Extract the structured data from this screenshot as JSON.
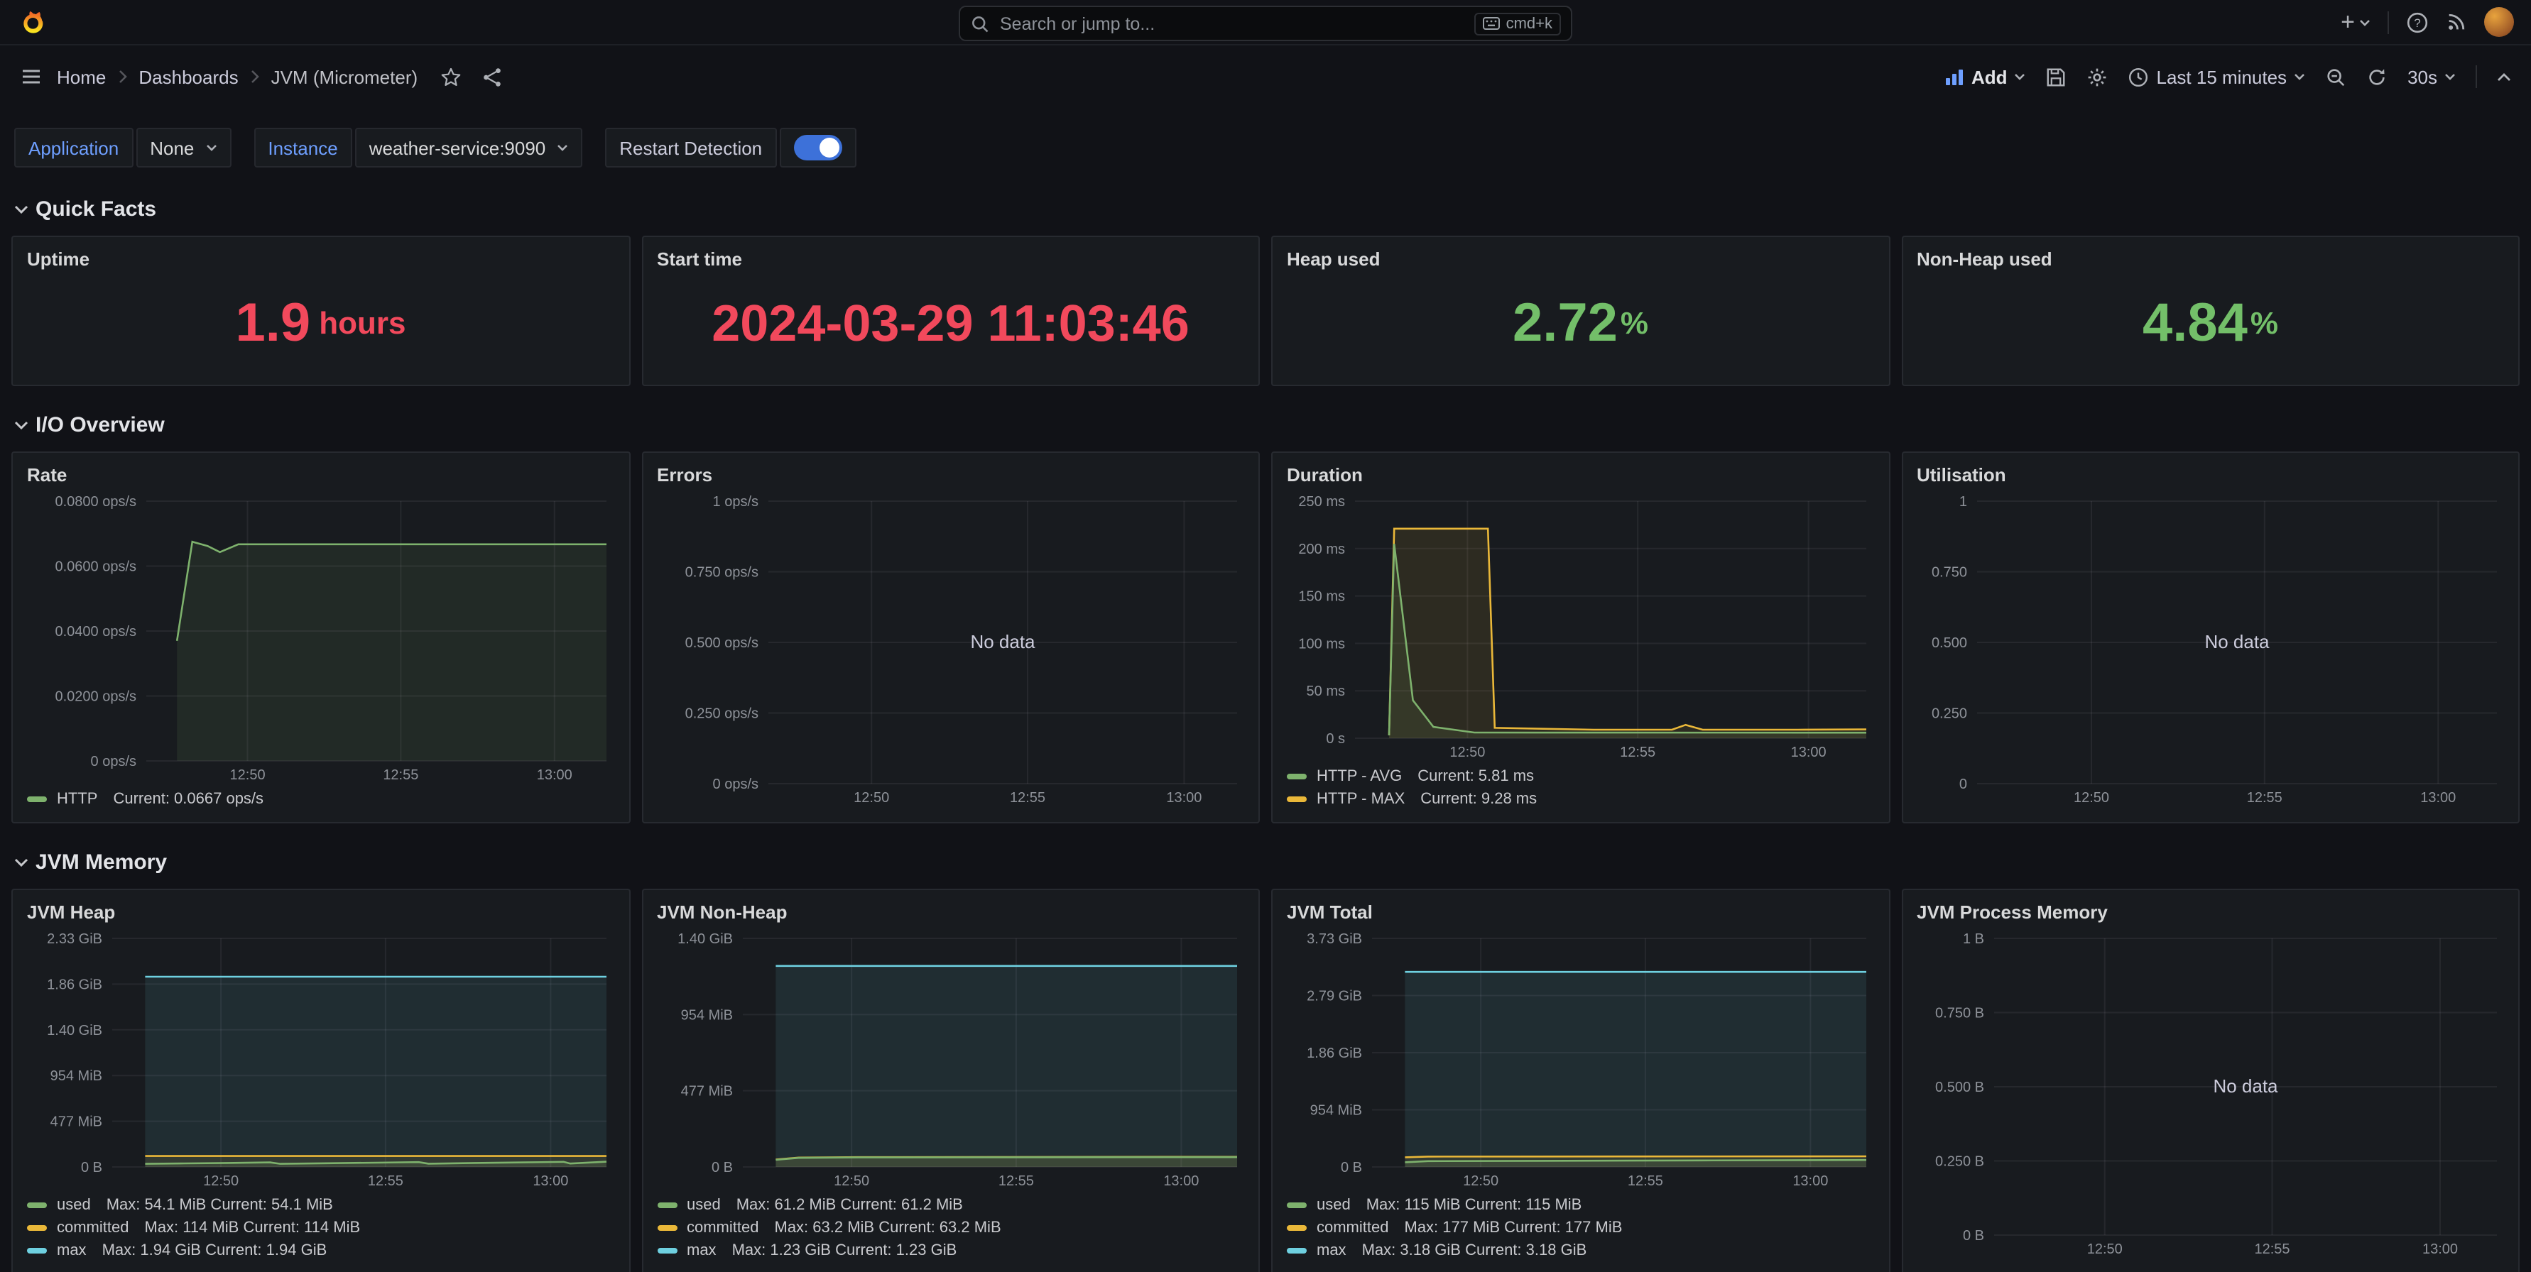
{
  "app": {
    "search_placeholder": "Search or jump to...",
    "shortcut": "cmd+k"
  },
  "breadcrumb": {
    "items": [
      "Home",
      "Dashboards",
      "JVM (Micrometer)"
    ]
  },
  "toolbar": {
    "add_label": "Add",
    "time_range": "Last 15 minutes",
    "refresh_interval": "30s"
  },
  "filters": {
    "application_label": "Application",
    "application_value": "None",
    "instance_label": "Instance",
    "instance_value": "weather-service:9090",
    "restart_detection_label": "Restart Detection",
    "restart_detection_enabled": true
  },
  "sections": {
    "quick_facts": "Quick Facts",
    "io_overview": "I/O Overview",
    "jvm_memory": "JVM Memory"
  },
  "quick_facts": {
    "panels": [
      {
        "title": "Uptime",
        "value": "1.9",
        "suffix": "hours",
        "color": "#F2495C"
      },
      {
        "title": "Start time",
        "value": "2024-03-29 11:03:46",
        "suffix": "",
        "color": "#F2495C"
      },
      {
        "title": "Heap used",
        "value": "2.72",
        "suffix": "%",
        "color": "#73BF69"
      },
      {
        "title": "Non-Heap used",
        "value": "4.84",
        "suffix": "%",
        "color": "#73BF69"
      }
    ]
  },
  "chart_data": {
    "rate": {
      "type": "line",
      "title": "Rate",
      "y_max": 0.08,
      "x_max": 15,
      "y_ticks": [
        "0 ops/s",
        "0.0200 ops/s",
        "0.0400 ops/s",
        "0.0600 ops/s",
        "0.0800 ops/s"
      ],
      "x_ticks": [
        {
          "label": "12:50",
          "f": 0.22
        },
        {
          "label": "12:55",
          "f": 0.553
        },
        {
          "label": "13:00",
          "f": 0.887
        }
      ],
      "no_data": false,
      "series": [
        {
          "name": "HTTP",
          "color": "#7EB26D",
          "points": [
            [
              1.0,
              0.037
            ],
            [
              1.5,
              0.0675
            ],
            [
              2.0,
              0.0662
            ],
            [
              2.4,
              0.0643
            ],
            [
              3.0,
              0.0667
            ],
            [
              15,
              0.0667
            ]
          ]
        }
      ],
      "legend": [
        {
          "name": "HTTP",
          "color": "#7EB26D",
          "stats": "Current: 0.0667 ops/s"
        }
      ]
    },
    "errors": {
      "type": "line",
      "title": "Errors",
      "y_max": 1,
      "x_max": 15,
      "y_ticks": [
        "0 ops/s",
        "0.250 ops/s",
        "0.500 ops/s",
        "0.750 ops/s",
        "1 ops/s"
      ],
      "x_ticks": [
        {
          "label": "12:50",
          "f": 0.22
        },
        {
          "label": "12:55",
          "f": 0.553
        },
        {
          "label": "13:00",
          "f": 0.887
        }
      ],
      "no_data": true,
      "no_data_text": "No data",
      "series": [],
      "legend": []
    },
    "duration": {
      "type": "line",
      "title": "Duration",
      "y_max": 250,
      "x_max": 15,
      "y_ticks": [
        "0 s",
        "50 ms",
        "100 ms",
        "150 ms",
        "200 ms",
        "250 ms"
      ],
      "x_ticks": [
        {
          "label": "12:50",
          "f": 0.22
        },
        {
          "label": "12:55",
          "f": 0.553
        },
        {
          "label": "13:00",
          "f": 0.887
        }
      ],
      "no_data": false,
      "series": [
        {
          "name": "HTTP - MAX",
          "color": "#EAB839",
          "points": [
            [
              1.0,
              3
            ],
            [
              1.15,
              221
            ],
            [
              3.9,
              221
            ],
            [
              4.1,
              11
            ],
            [
              7,
              9
            ],
            [
              9.3,
              9
            ],
            [
              9.7,
              14
            ],
            [
              10.2,
              9
            ],
            [
              13,
              9
            ],
            [
              15,
              9.3
            ]
          ]
        },
        {
          "name": "HTTP - AVG",
          "color": "#7EB26D",
          "points": [
            [
              1.0,
              3
            ],
            [
              1.15,
              205
            ],
            [
              1.7,
              40
            ],
            [
              2.3,
              12
            ],
            [
              3.5,
              6
            ],
            [
              15,
              5.8
            ]
          ]
        }
      ],
      "legend": [
        {
          "name": "HTTP - AVG",
          "color": "#7EB26D",
          "stats": "Current: 5.81 ms"
        },
        {
          "name": "HTTP - MAX",
          "color": "#EAB839",
          "stats": "Current: 9.28 ms"
        }
      ]
    },
    "utilisation": {
      "type": "line",
      "title": "Utilisation",
      "y_max": 1,
      "x_max": 15,
      "y_ticks": [
        "0",
        "0.250",
        "0.500",
        "0.750",
        "1"
      ],
      "x_ticks": [
        {
          "label": "12:50",
          "f": 0.22
        },
        {
          "label": "12:55",
          "f": 0.553
        },
        {
          "label": "13:00",
          "f": 0.887
        }
      ],
      "no_data": true,
      "no_data_text": "No data",
      "series": [],
      "legend": []
    },
    "jvm_heap": {
      "type": "line",
      "title": "JVM Heap",
      "y_max": 2386,
      "x_max": 15,
      "y_ticks": [
        "0 B",
        "477 MiB",
        "954 MiB",
        "1.40 GiB",
        "1.86 GiB",
        "2.33 GiB"
      ],
      "x_ticks": [
        {
          "label": "12:50",
          "f": 0.22
        },
        {
          "label": "12:55",
          "f": 0.553
        },
        {
          "label": "13:00",
          "f": 0.887
        }
      ],
      "no_data": false,
      "series": [
        {
          "name": "max",
          "color": "#6ED0E0",
          "points": [
            [
              1,
              1986
            ],
            [
              15,
              1986
            ]
          ]
        },
        {
          "name": "committed",
          "color": "#EAB839",
          "points": [
            [
              1,
              114
            ],
            [
              15,
              114
            ]
          ]
        },
        {
          "name": "used",
          "color": "#7EB26D",
          "points": [
            [
              1,
              33
            ],
            [
              2.2,
              37
            ],
            [
              3.5,
              42
            ],
            [
              4.8,
              47
            ],
            [
              5.1,
              33
            ],
            [
              6.5,
              39
            ],
            [
              8,
              45
            ],
            [
              9.3,
              51
            ],
            [
              9.6,
              34
            ],
            [
              11,
              41
            ],
            [
              12.5,
              48
            ],
            [
              13.7,
              54
            ],
            [
              13.9,
              35
            ],
            [
              15,
              54.1
            ]
          ]
        }
      ],
      "legend": [
        {
          "name": "used",
          "color": "#7EB26D",
          "stats": "Max: 54.1 MiB Current: 54.1 MiB"
        },
        {
          "name": "committed",
          "color": "#EAB839",
          "stats": "Max: 114 MiB Current: 114 MiB"
        },
        {
          "name": "max",
          "color": "#6ED0E0",
          "stats": "Max: 1.94 GiB Current: 1.94 GiB"
        }
      ]
    },
    "jvm_nonheap": {
      "type": "line",
      "title": "JVM Non-Heap",
      "y_max": 1431,
      "x_max": 15,
      "y_ticks": [
        "0 B",
        "477 MiB",
        "954 MiB",
        "1.40 GiB"
      ],
      "x_ticks": [
        {
          "label": "12:50",
          "f": 0.22
        },
        {
          "label": "12:55",
          "f": 0.553
        },
        {
          "label": "13:00",
          "f": 0.887
        }
      ],
      "no_data": false,
      "series": [
        {
          "name": "max",
          "color": "#6ED0E0",
          "points": [
            [
              1,
              1259
            ],
            [
              15,
              1259
            ]
          ]
        },
        {
          "name": "committed",
          "color": "#EAB839",
          "points": [
            [
              1,
              46
            ],
            [
              1.7,
              59
            ],
            [
              3.5,
              61.5
            ],
            [
              8,
              62.5
            ],
            [
              15,
              63.2
            ]
          ]
        },
        {
          "name": "used",
          "color": "#7EB26D",
          "points": [
            [
              1,
              44
            ],
            [
              1.7,
              57
            ],
            [
              3.5,
              59.5
            ],
            [
              8,
              60.5
            ],
            [
              15,
              61.2
            ]
          ]
        }
      ],
      "legend": [
        {
          "name": "used",
          "color": "#7EB26D",
          "stats": "Max: 61.2 MiB Current: 61.2 MiB"
        },
        {
          "name": "committed",
          "color": "#EAB839",
          "stats": "Max: 63.2 MiB Current: 63.2 MiB"
        },
        {
          "name": "max",
          "color": "#6ED0E0",
          "stats": "Max: 1.23 GiB Current: 1.23 GiB"
        }
      ]
    },
    "jvm_total": {
      "type": "line",
      "title": "JVM Total",
      "y_max": 3816,
      "x_max": 15,
      "y_ticks": [
        "0 B",
        "954 MiB",
        "1.86 GiB",
        "2.79 GiB",
        "3.73 GiB"
      ],
      "x_ticks": [
        {
          "label": "12:50",
          "f": 0.22
        },
        {
          "label": "12:55",
          "f": 0.553
        },
        {
          "label": "13:00",
          "f": 0.887
        }
      ],
      "no_data": false,
      "series": [
        {
          "name": "max",
          "color": "#6ED0E0",
          "points": [
            [
              1,
              3256
            ],
            [
              15,
              3256
            ]
          ]
        },
        {
          "name": "committed",
          "color": "#EAB839",
          "points": [
            [
              1,
              160
            ],
            [
              1.7,
              172
            ],
            [
              8,
              175
            ],
            [
              15,
              177
            ]
          ]
        },
        {
          "name": "used",
          "color": "#7EB26D",
          "points": [
            [
              1,
              78
            ],
            [
              1.7,
              96
            ],
            [
              5,
              102
            ],
            [
              10,
              109
            ],
            [
              15,
              115
            ]
          ]
        }
      ],
      "legend": [
        {
          "name": "used",
          "color": "#7EB26D",
          "stats": "Max: 115 MiB Current: 115 MiB"
        },
        {
          "name": "committed",
          "color": "#EAB839",
          "stats": "Max: 177 MiB Current: 177 MiB"
        },
        {
          "name": "max",
          "color": "#6ED0E0",
          "stats": "Max: 3.18 GiB Current: 3.18 GiB"
        }
      ]
    },
    "jvm_process": {
      "type": "line",
      "title": "JVM Process Memory",
      "y_max": 1,
      "x_max": 15,
      "y_ticks": [
        "0 B",
        "0.250 B",
        "0.500 B",
        "0.750 B",
        "1 B"
      ],
      "x_ticks": [
        {
          "label": "12:50",
          "f": 0.22
        },
        {
          "label": "12:55",
          "f": 0.553
        },
        {
          "label": "13:00",
          "f": 0.887
        }
      ],
      "no_data": true,
      "no_data_text": "No data",
      "series": [],
      "legend": []
    }
  }
}
